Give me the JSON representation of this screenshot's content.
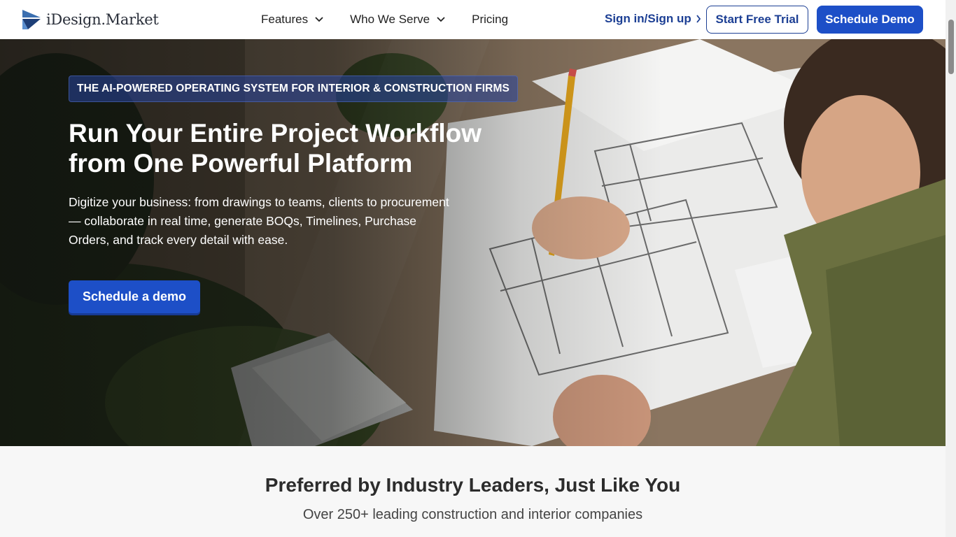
{
  "header": {
    "logo_text": "iDesign.Market",
    "nav": [
      {
        "label": "Features",
        "has_dropdown": true
      },
      {
        "label": "Who We Serve",
        "has_dropdown": true
      },
      {
        "label": "Pricing",
        "has_dropdown": false
      }
    ],
    "signin_label": "Sign in/Sign up",
    "trial_label": "Start Free Trial",
    "demo_label": "Schedule Demo"
  },
  "hero": {
    "badge": "THE AI-POWERED OPERATING SYSTEM FOR INTERIOR & CONSTRUCTION FIRMS",
    "title": "Run Your Entire Project Workflow from One Powerful Platform",
    "subtitle": "Digitize your business: from drawings to teams, clients to procurement — collaborate in real time, generate BOQs, Timelines, Purchase Orders, and track every detail with ease.",
    "cta_label": "Schedule a demo"
  },
  "social_proof": {
    "title": "Preferred by Industry Leaders, Just Like You",
    "subtitle": "Over 250+ leading construction and interior companies"
  },
  "colors": {
    "brand_blue": "#1d4fc7",
    "link_blue": "#1c3f94"
  },
  "icons": {
    "logo": "idesign-logo-icon",
    "dropdown": "chevron-down-icon",
    "signin_arrow": "chevron-right-icon"
  }
}
